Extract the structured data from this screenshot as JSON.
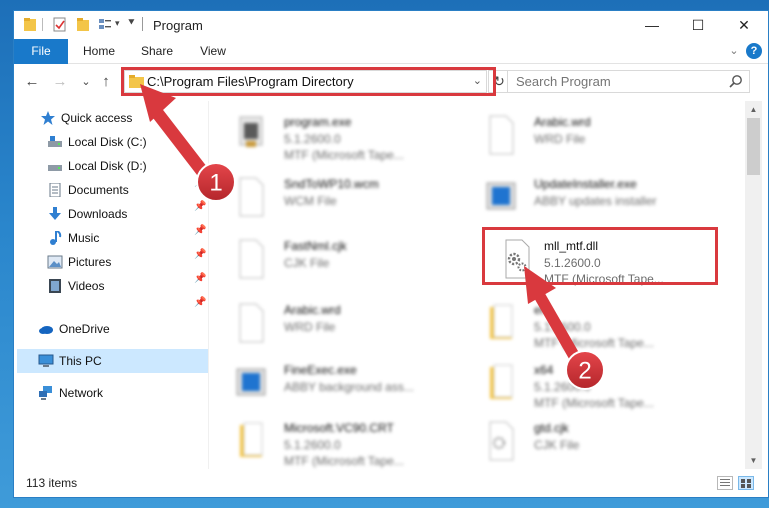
{
  "window": {
    "title": "Program",
    "minimize": "—",
    "maximize": "☐",
    "close": "✕"
  },
  "ribbon": {
    "tabs": [
      "File",
      "Home",
      "Share",
      "View"
    ],
    "help": "?"
  },
  "nav": {
    "back": "←",
    "forward": "→",
    "recent": "⌄",
    "up": "↑"
  },
  "address": {
    "path": "C:\\Program Files\\Program Directory",
    "dropdown": "⌄",
    "refresh": "↻"
  },
  "search": {
    "placeholder": "Search Program"
  },
  "sidebar": {
    "items": [
      {
        "label": "Quick access",
        "icon": "star-icon"
      },
      {
        "label": "Local Disk (C:)",
        "icon": "drive-icon"
      },
      {
        "label": "Local Disk (D:)",
        "icon": "drive-icon"
      },
      {
        "label": "Documents",
        "icon": "documents-icon"
      },
      {
        "label": "Downloads",
        "icon": "download-icon"
      },
      {
        "label": "Music",
        "icon": "music-icon"
      },
      {
        "label": "Pictures",
        "icon": "pictures-icon"
      },
      {
        "label": "Videos",
        "icon": "videos-icon"
      },
      {
        "label": "OneDrive",
        "icon": "cloud-icon"
      },
      {
        "label": "This PC",
        "icon": "computer-icon"
      },
      {
        "label": "Network",
        "icon": "network-icon"
      }
    ],
    "pin": "📌"
  },
  "files": [
    {
      "name": "program.exe",
      "line1": "5.1.2600.0",
      "line2": "MTF (Microsoft Tape...",
      "icon": "exe-icon"
    },
    {
      "name": "Arabic.wrd",
      "line1": "WRD File",
      "line2": "",
      "icon": "file-icon"
    },
    {
      "name": "SndToWP10.wcm",
      "line1": "WCM File",
      "line2": "",
      "icon": "file-icon"
    },
    {
      "name": "UpdateInstaller.exe",
      "line1": "ABBY updates installer",
      "line2": "",
      "icon": "installer-icon"
    },
    {
      "name": "FastNml.cjk",
      "line1": "CJK File",
      "line2": "",
      "icon": "file-icon"
    },
    {
      "name": "mll_mtf.dll",
      "line1": "5.1.2600.0",
      "line2": "MTF (Microsoft Tape...",
      "icon": "dll-gear-icon"
    },
    {
      "name": "Arabic.wrd",
      "line1": "WRD File",
      "line2": "",
      "icon": "file-icon"
    },
    {
      "name": "el",
      "line1": "5.1.2600.0",
      "line2": "MTF (Microsoft Tape...",
      "icon": "folder-file-icon"
    },
    {
      "name": "FineExec.exe",
      "line1": "ABBY background ass...",
      "line2": "",
      "icon": "installer-icon"
    },
    {
      "name": "x64",
      "line1": "5.1.2600.0",
      "line2": "MTF (Microsoft Tape...",
      "icon": "folder-file-icon"
    },
    {
      "name": "Microsoft.VC90.CRT",
      "line1": "5.1.2600.0",
      "line2": "MTF (Microsoft Tape...",
      "icon": "folder-file-icon"
    },
    {
      "name": "gtd.cjk",
      "line1": "CJK File",
      "line2": "",
      "icon": "gear-file-icon"
    }
  ],
  "status": {
    "count": "113 items"
  },
  "annotations": {
    "step1": "1",
    "step2": "2",
    "color": "#d9393e"
  }
}
